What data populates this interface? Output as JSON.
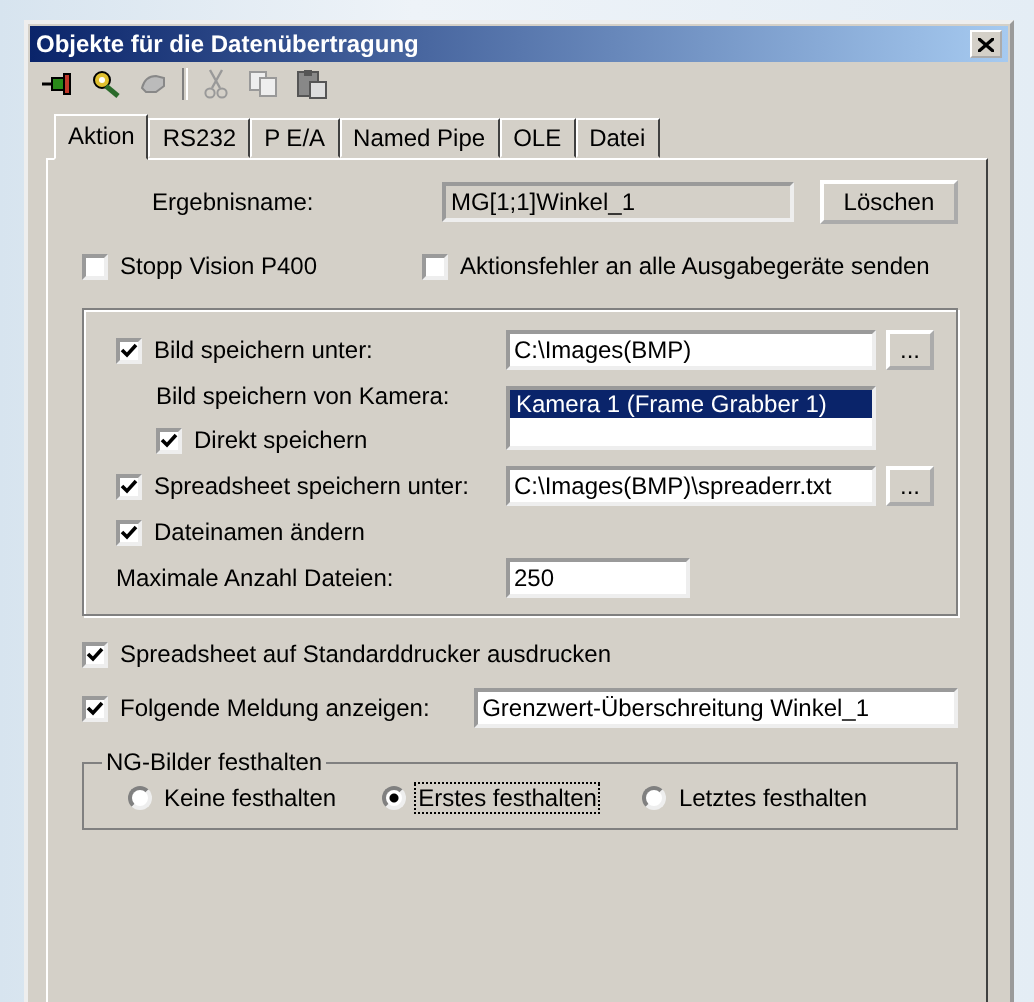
{
  "window": {
    "title": "Objekte für die Datenübertragung"
  },
  "tabs": [
    {
      "label": "Aktion",
      "selected": true
    },
    {
      "label": "RS232",
      "selected": false
    },
    {
      "label": "P E/A",
      "selected": false
    },
    {
      "label": "Named Pipe",
      "selected": false
    },
    {
      "label": "OLE",
      "selected": false
    },
    {
      "label": "Datei",
      "selected": false
    }
  ],
  "result": {
    "label": "Ergebnisname:",
    "value": "MG[1;1]Winkel_1",
    "button": "Löschen"
  },
  "options": [
    {
      "label": "Stopp Vision P400",
      "checked": false
    },
    {
      "label": "Aktionsfehler an alle Ausgabegeräte senden",
      "checked": false
    }
  ],
  "save_group": {
    "image": {
      "label": "Bild speichern unter:",
      "checked": true,
      "path": "C:\\Images(BMP)",
      "browse": "..."
    },
    "camera": {
      "label": "Bild speichern von Kamera:",
      "items": [
        {
          "label": "Kamera  1  (Frame Grabber 1)",
          "selected": true
        }
      ]
    },
    "direct": {
      "label": "Direkt speichern",
      "checked": true
    },
    "spreadsheet": {
      "label": "Spreadsheet speichern unter:",
      "checked": true,
      "path": "C:\\Images(BMP)\\spreaderr.txt",
      "browse": "..."
    },
    "rename": {
      "label": "Dateinamen ändern",
      "checked": true
    },
    "max_files": {
      "label": "Maximale Anzahl Dateien:",
      "value": "250"
    }
  },
  "print": {
    "label": "Spreadsheet auf Standarddrucker ausdrucken",
    "checked": true
  },
  "message": {
    "label": "Folgende Meldung anzeigen:",
    "checked": true,
    "value": "Grenzwert-Überschreitung Winkel_1"
  },
  "ng_group": {
    "title": "NG-Bilder festhalten",
    "options": [
      {
        "label": "Keine festhalten",
        "selected": false
      },
      {
        "label": "Erstes festhalten",
        "selected": true
      },
      {
        "label": "Letztes festhalten",
        "selected": false
      }
    ]
  }
}
